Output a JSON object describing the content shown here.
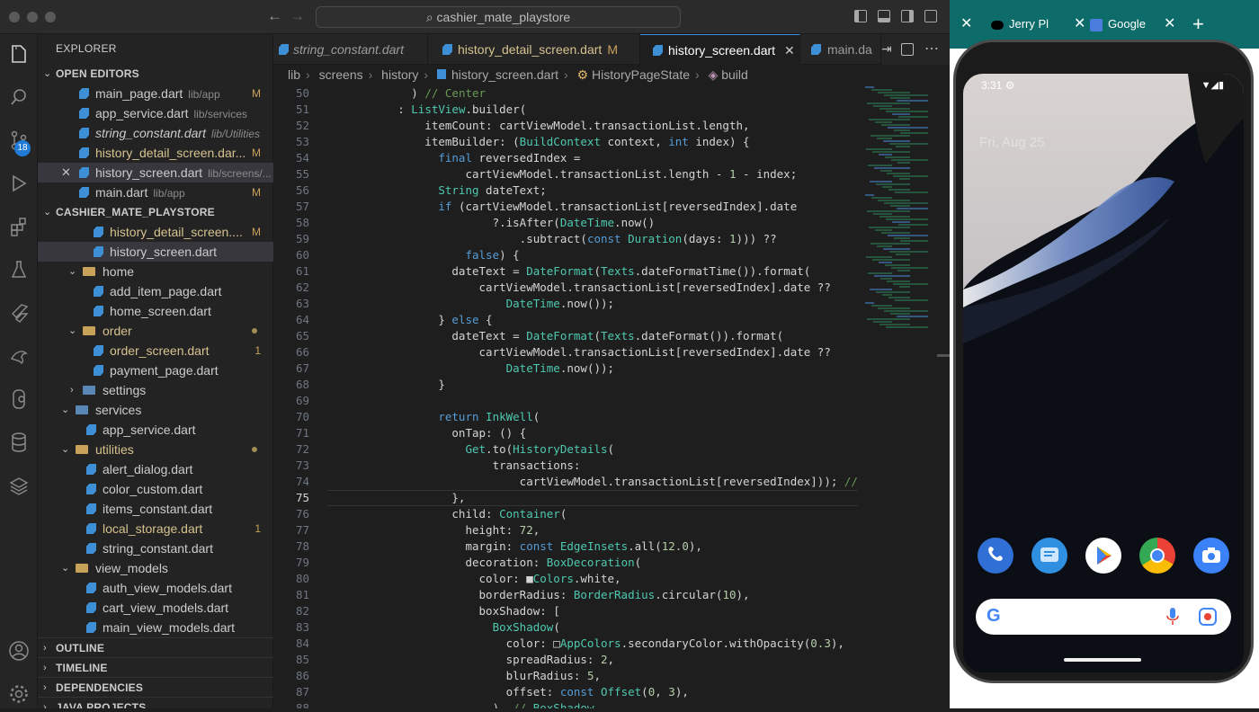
{
  "window": {
    "search": "cashier_mate_playstore"
  },
  "activity": {
    "badge": "18"
  },
  "explorer": {
    "title": "EXPLORER",
    "open_editors_title": "OPEN EDITORS",
    "open_editors": [
      {
        "name": "main_page.dart",
        "path": "lib/app",
        "status": "M"
      },
      {
        "name": "app_service.dart",
        "path": "lib/services",
        "status": ""
      },
      {
        "name": "string_constant.dart",
        "path": "lib/Utilities",
        "status": ""
      },
      {
        "name": "history_detail_screen.dar...",
        "path": "",
        "status": "M"
      },
      {
        "name": "history_screen.dart",
        "path": "lib/screens/...",
        "status": ""
      },
      {
        "name": "main.dart",
        "path": "lib/app",
        "status": "M"
      }
    ],
    "project_title": "CASHIER_MATE_PLAYSTORE",
    "tree": [
      {
        "name": "history_detail_screen....",
        "status": "M"
      },
      {
        "name": "history_screen.dart",
        "status": ""
      },
      {
        "name": "home",
        "status": ""
      },
      {
        "name": "add_item_page.dart",
        "status": ""
      },
      {
        "name": "home_screen.dart",
        "status": ""
      },
      {
        "name": "order",
        "status": ""
      },
      {
        "name": "order_screen.dart",
        "status": "1"
      },
      {
        "name": "payment_page.dart",
        "status": ""
      },
      {
        "name": "settings",
        "status": ""
      },
      {
        "name": "services",
        "status": ""
      },
      {
        "name": "app_service.dart",
        "status": ""
      },
      {
        "name": "utilities",
        "status": ""
      },
      {
        "name": "alert_dialog.dart",
        "status": ""
      },
      {
        "name": "color_custom.dart",
        "status": ""
      },
      {
        "name": "items_constant.dart",
        "status": ""
      },
      {
        "name": "local_storage.dart",
        "status": "1"
      },
      {
        "name": "string_constant.dart",
        "status": ""
      },
      {
        "name": "view_models",
        "status": ""
      },
      {
        "name": "auth_view_models.dart",
        "status": ""
      },
      {
        "name": "cart_view_models.dart",
        "status": ""
      },
      {
        "name": "main_view_models.dart",
        "status": ""
      }
    ],
    "sections": [
      "OUTLINE",
      "TIMELINE",
      "DEPENDENCIES",
      "JAVA PROJECTS"
    ]
  },
  "tabs": [
    {
      "label": "string_constant.dart",
      "mod": ""
    },
    {
      "label": "history_detail_screen.dart",
      "mod": "M"
    },
    {
      "label": "history_screen.dart",
      "mod": ""
    },
    {
      "label": "main.da",
      "mod": ""
    }
  ],
  "breadcrumb": [
    "lib",
    "screens",
    "history",
    "history_screen.dart",
    "HistoryPageState",
    "build"
  ],
  "code": [
    {
      "n": "50",
      "t": "          ) // Center"
    },
    {
      "n": "51",
      "t": "        : ListView.builder("
    },
    {
      "n": "52",
      "t": "            itemCount: cartViewModel.transactionList.length,"
    },
    {
      "n": "53",
      "t": "            itemBuilder: (BuildContext context, int index) {"
    },
    {
      "n": "54",
      "t": "              final reversedIndex ="
    },
    {
      "n": "55",
      "t": "                  cartViewModel.transactionList.length - 1 - index;"
    },
    {
      "n": "56",
      "t": "              String dateText;"
    },
    {
      "n": "57",
      "t": "              if (cartViewModel.transactionList[reversedIndex].date"
    },
    {
      "n": "58",
      "t": "                      ?.isAfter(DateTime.now()"
    },
    {
      "n": "59",
      "t": "                          .subtract(const Duration(days: 1))) ??"
    },
    {
      "n": "60",
      "t": "                  false) {"
    },
    {
      "n": "61",
      "t": "                dateText = DateFormat(Texts.dateFormatTime()).format("
    },
    {
      "n": "62",
      "t": "                    cartViewModel.transactionList[reversedIndex].date ??"
    },
    {
      "n": "63",
      "t": "                        DateTime.now());"
    },
    {
      "n": "64",
      "t": "              } else {"
    },
    {
      "n": "65",
      "t": "                dateText = DateFormat(Texts.dateFormat()).format("
    },
    {
      "n": "66",
      "t": "                    cartViewModel.transactionList[reversedIndex].date ??"
    },
    {
      "n": "67",
      "t": "                        DateTime.now());"
    },
    {
      "n": "68",
      "t": "              }"
    },
    {
      "n": "69",
      "t": ""
    },
    {
      "n": "70",
      "t": "              return InkWell("
    },
    {
      "n": "71",
      "t": "                onTap: () {"
    },
    {
      "n": "72",
      "t": "                  Get.to(HistoryDetails("
    },
    {
      "n": "73",
      "t": "                      transactions:"
    },
    {
      "n": "74",
      "t": "                          cartViewModel.transactionList[reversedIndex])); //"
    },
    {
      "n": "75",
      "t": "                },"
    },
    {
      "n": "76",
      "t": "                child: Container("
    },
    {
      "n": "77",
      "t": "                  height: 72,"
    },
    {
      "n": "78",
      "t": "                  margin: const EdgeInsets.all(12.0),"
    },
    {
      "n": "79",
      "t": "                  decoration: BoxDecoration("
    },
    {
      "n": "80",
      "t": "                    color: ■Colors.white,"
    },
    {
      "n": "81",
      "t": "                    borderRadius: BorderRadius.circular(10),"
    },
    {
      "n": "82",
      "t": "                    boxShadow: ["
    },
    {
      "n": "83",
      "t": "                      BoxShadow("
    },
    {
      "n": "84",
      "t": "                        color: □AppColors.secondaryColor.withOpacity(0.3),"
    },
    {
      "n": "85",
      "t": "                        spreadRadius: 2,"
    },
    {
      "n": "86",
      "t": "                        blurRadius: 5,"
    },
    {
      "n": "87",
      "t": "                        offset: const Offset(0, 3),"
    },
    {
      "n": "88",
      "t": "                      ), // BoxShadow"
    }
  ],
  "chrome": {
    "tabs": [
      {
        "label": "Jerry Pl"
      },
      {
        "label": "Google"
      }
    ],
    "new_tab": "+"
  },
  "phone": {
    "time": "3:31",
    "date": "Fri, Aug 25"
  }
}
